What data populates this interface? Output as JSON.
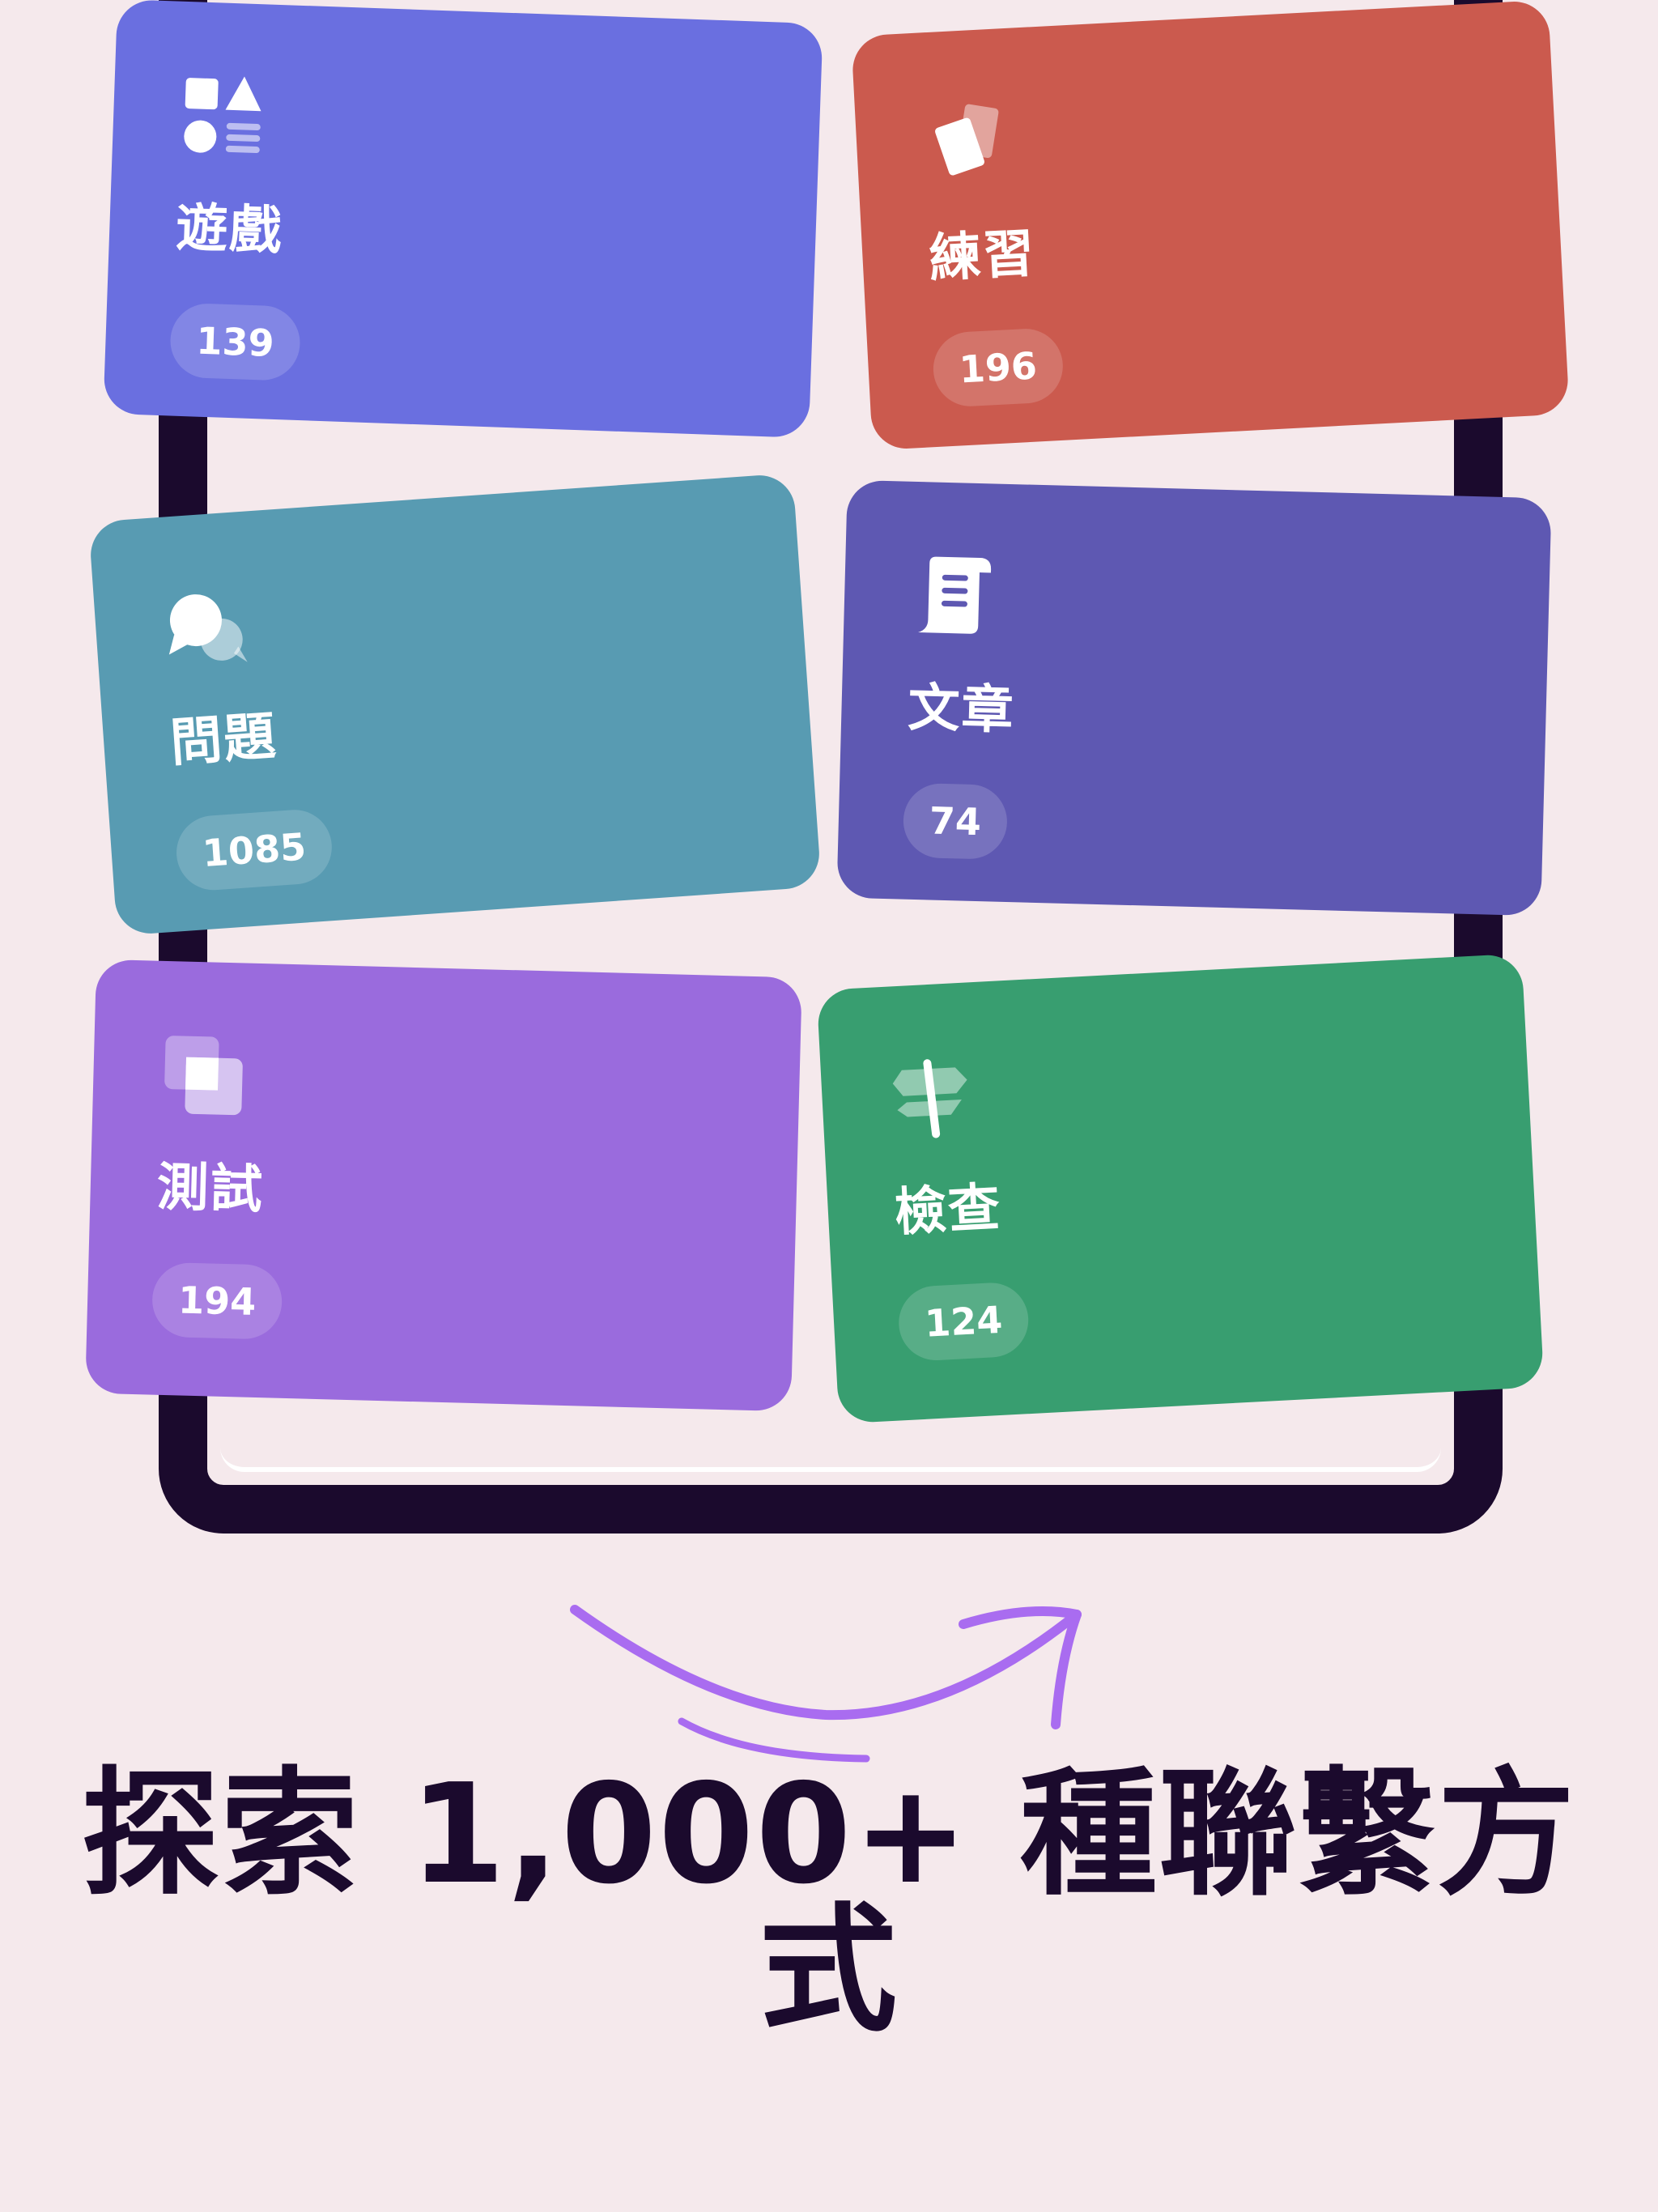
{
  "cards": [
    {
      "id": "games",
      "title": "遊戲",
      "count": "139",
      "icon": "shapes-icon"
    },
    {
      "id": "practice",
      "title": "練習",
      "count": "196",
      "icon": "flashcards-icon"
    },
    {
      "id": "questions",
      "title": "問題",
      "count": "1085",
      "icon": "chat-bubbles-icon"
    },
    {
      "id": "articles",
      "title": "文章",
      "count": "74",
      "icon": "scroll-icon"
    },
    {
      "id": "tests",
      "title": "測試",
      "count": "194",
      "icon": "layers-icon"
    },
    {
      "id": "checks",
      "title": "檢查",
      "count": "124",
      "icon": "signpost-icon"
    }
  ],
  "headline": "探索 1,000+ 種聯繫方式",
  "colors": {
    "background": "#f5e9ec",
    "device_frame": "#1b0a2d",
    "games": "#6a6fe0",
    "practice": "#cb5a4e",
    "questions": "#589bb2",
    "articles": "#5e58b2",
    "tests": "#9a6bdd",
    "checks": "#389e70",
    "arrow": "#a96cf0"
  }
}
